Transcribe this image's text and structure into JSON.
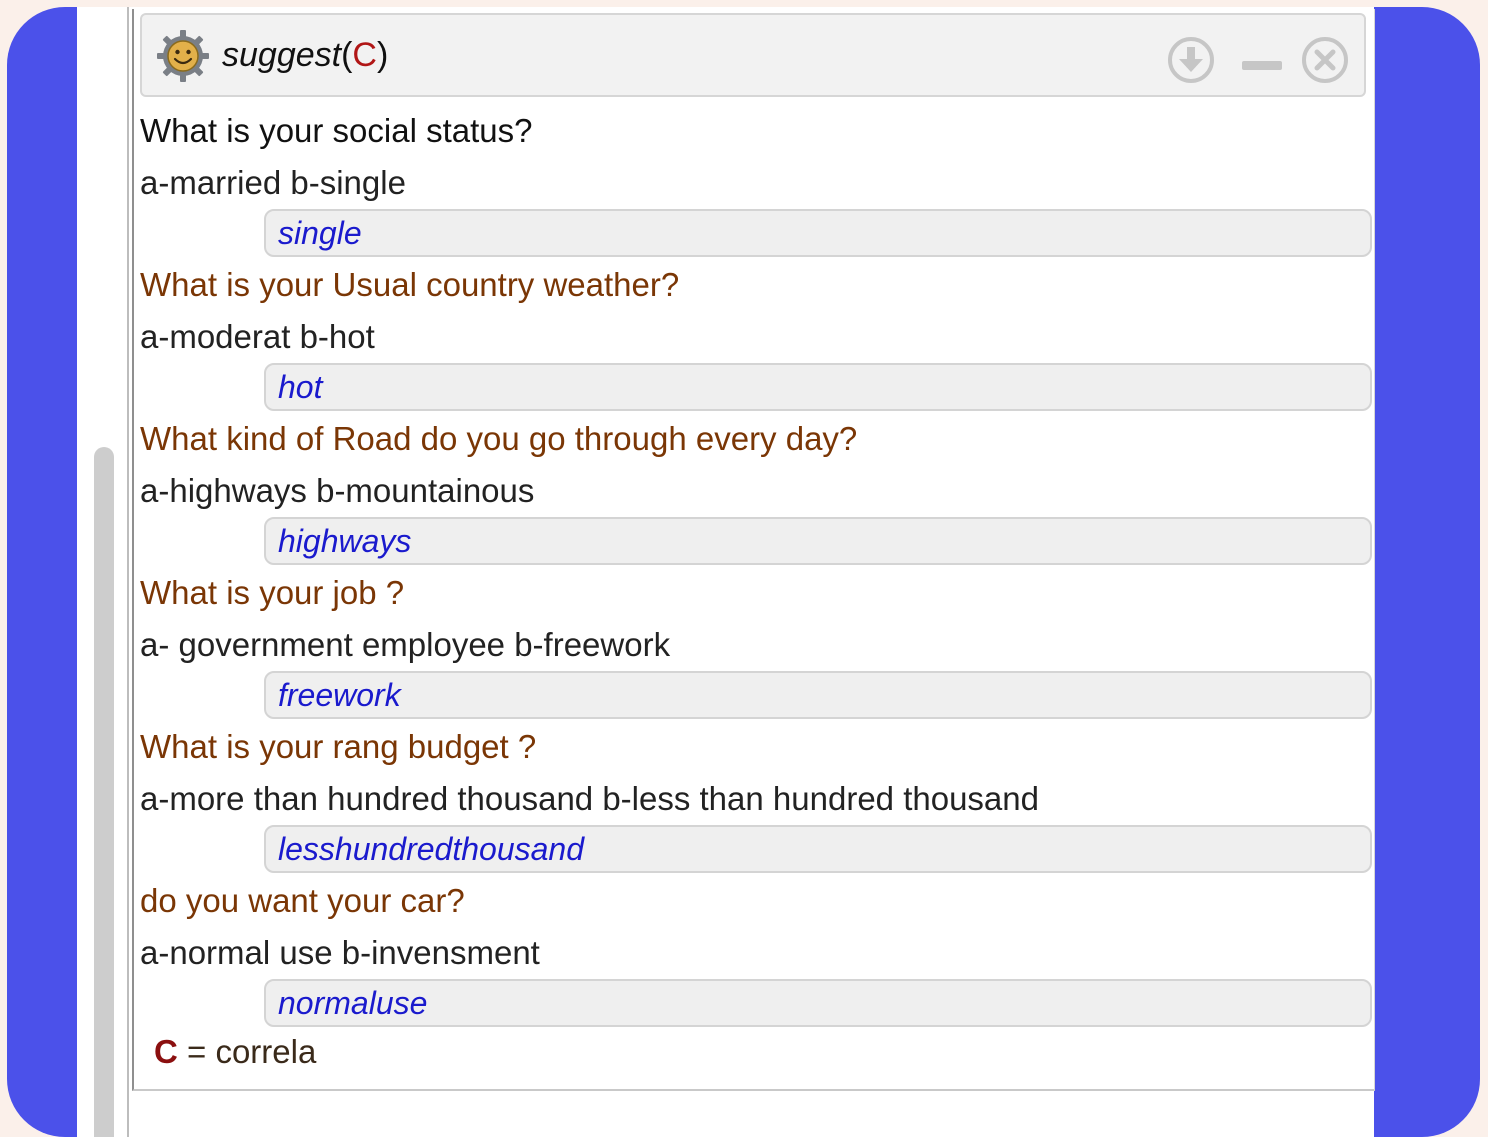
{
  "window": {
    "title_main": "suggest",
    "title_open": "(",
    "title_accent": "C",
    "title_close": ")",
    "logo_icon": "smiley-gear-icon",
    "buttons": {
      "download_icon": "download-circle-icon",
      "minimize_icon": "minimize-icon",
      "close_icon": "close-circle-icon"
    }
  },
  "questions": [
    {
      "question": "What is your social status?",
      "options": "a-married b-single",
      "answer": "single",
      "color": "dark"
    },
    {
      "question": "What is your Usual country weather?",
      "options": "a-moderat b-hot",
      "answer": "hot",
      "color": "brown"
    },
    {
      "question": "What kind of Road do you go through every day?",
      "options": "a-highways b-mountainous",
      "answer": "highways",
      "color": "brown"
    },
    {
      "question": "What is your job ?",
      "options": "a- government employee b-freework",
      "answer": "freework",
      "color": "brown"
    },
    {
      "question": "What is your rang budget ?",
      "options": "a-more than hundred thousand b-less than hundred thousand",
      "answer": "lesshundredthousand",
      "color": "brown"
    },
    {
      "question": "do you want your car?",
      "options": "a-normal use b-invensment",
      "answer": "normaluse",
      "color": "brown"
    }
  ],
  "legend": {
    "symbol": "C",
    "text": " = correla"
  },
  "colors": {
    "frame": "#4b51ea",
    "question_brown": "#7a3605",
    "answer_blue": "#1a1acd",
    "accent_red": "#b11616"
  }
}
